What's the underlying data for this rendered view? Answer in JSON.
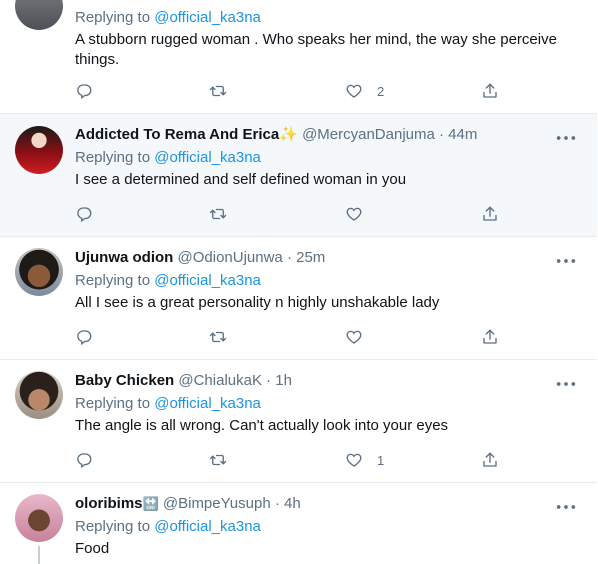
{
  "tweets": [
    {
      "reply_label": "Replying to",
      "reply_to": "@official_ka3na",
      "text": "A stubborn rugged woman . Who speaks her mind, the way she perceive things.",
      "likes": "2"
    },
    {
      "name": "Addicted To Rema And Erica",
      "name_emoji": "✨",
      "handle": "@MercyanDanjuma · 44m",
      "reply_label": "Replying to",
      "reply_to": "@official_ka3na",
      "text": "I see a determined and self defined woman in you",
      "likes": ""
    },
    {
      "name": "Ujunwa odion",
      "handle": "@OdionUjunwa · 25m",
      "reply_label": "Replying to",
      "reply_to": "@official_ka3na",
      "text": "All I see is a great personality n highly unshakable lady",
      "likes": ""
    },
    {
      "name": "Baby Chicken",
      "handle": "@ChialukaK · 1h",
      "reply_label": "Replying to",
      "reply_to": "@official_ka3na",
      "text": "The angle is all wrong. Can't actually look into your eyes",
      "likes": "1"
    },
    {
      "name": "oloribims",
      "name_emoji": "🔛",
      "handle": "@BimpeYusuph · 4h",
      "reply_label": "Replying to",
      "reply_to": "@official_ka3na",
      "text": "Food"
    }
  ],
  "icons": {
    "reply": "reply-icon",
    "retweet": "retweet-icon",
    "like": "heart-icon",
    "share": "share-icon",
    "more": "more-icon"
  },
  "colors": {
    "link": "#1b95e0",
    "muted": "#5b7083",
    "highlight_bg": "#f5f8fa"
  }
}
